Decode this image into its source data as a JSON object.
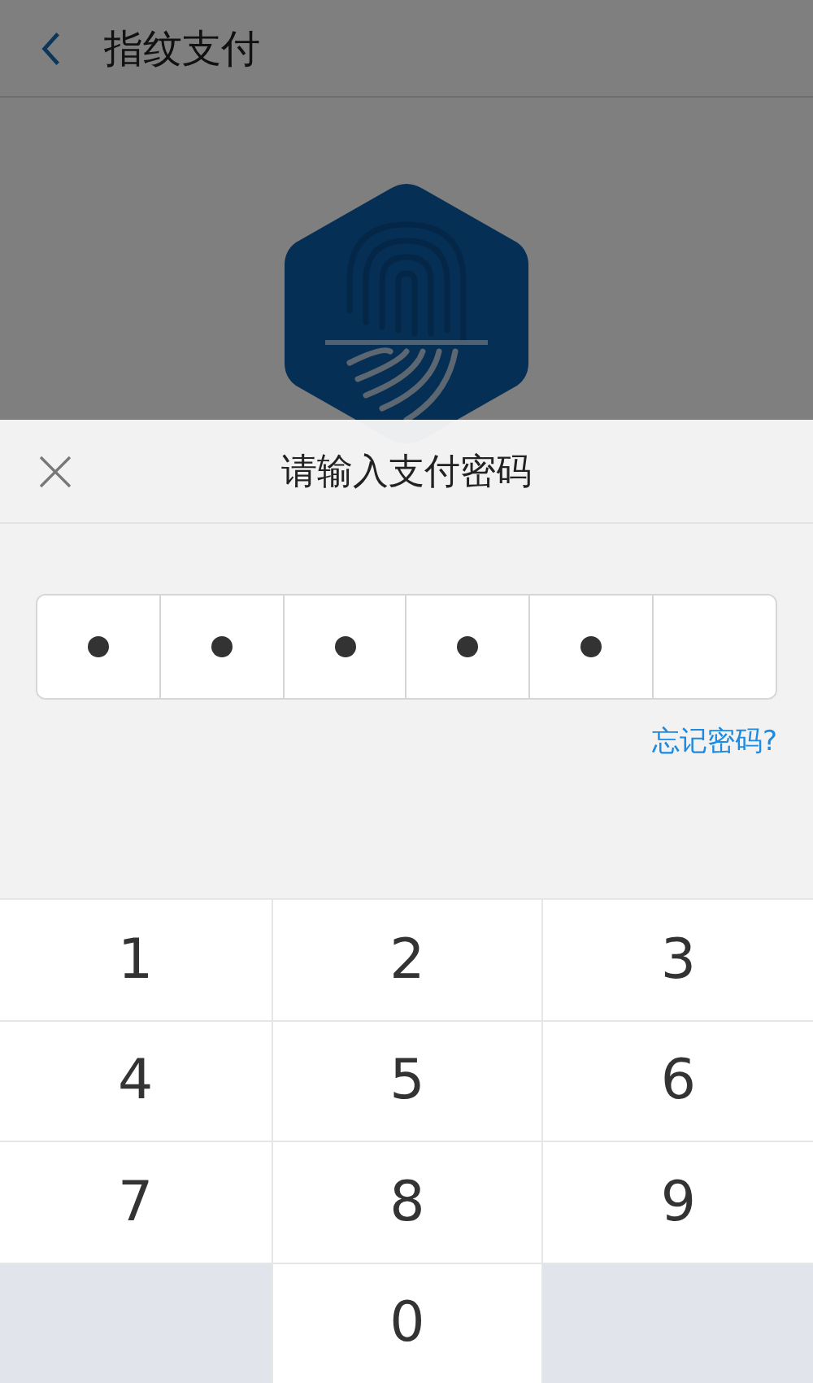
{
  "header": {
    "title": "指纹支付"
  },
  "password_sheet": {
    "title": "请输入支付密码",
    "pin_slots": [
      {
        "filled": true
      },
      {
        "filled": true
      },
      {
        "filled": true
      },
      {
        "filled": true
      },
      {
        "filled": true
      },
      {
        "filled": false
      }
    ],
    "forgot_link": "忘记密码?",
    "keypad": [
      {
        "kind": "digit",
        "label": "1"
      },
      {
        "kind": "digit",
        "label": "2"
      },
      {
        "kind": "digit",
        "label": "3"
      },
      {
        "kind": "digit",
        "label": "4"
      },
      {
        "kind": "digit",
        "label": "5"
      },
      {
        "kind": "digit",
        "label": "6"
      },
      {
        "kind": "digit",
        "label": "7"
      },
      {
        "kind": "digit",
        "label": "8"
      },
      {
        "kind": "digit",
        "label": "9"
      },
      {
        "kind": "blank"
      },
      {
        "kind": "digit",
        "label": "0"
      },
      {
        "kind": "blank"
      }
    ]
  }
}
